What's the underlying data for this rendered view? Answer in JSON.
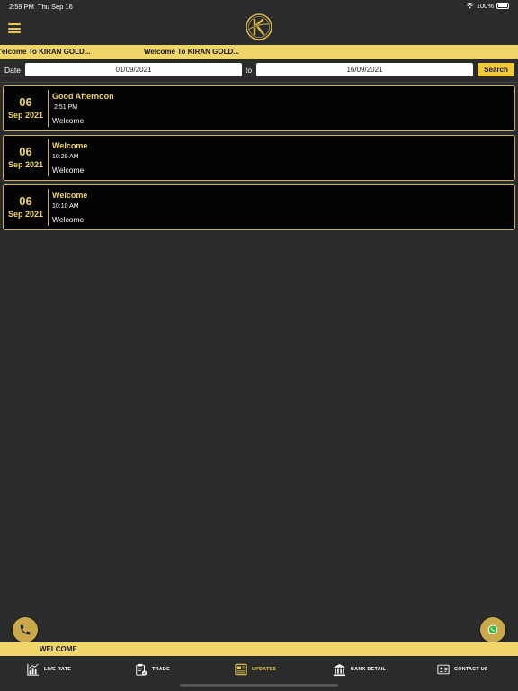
{
  "status": {
    "time": "2:59 PM",
    "date": "Thu Sep 16",
    "battery": "100%"
  },
  "marquee": {
    "items": [
      "'elcome To KIRAN GOLD...",
      "Welcome To KIRAN GOLD..."
    ]
  },
  "filter": {
    "date_label": "Date",
    "from_value": "01/09/2021",
    "to_label": "to",
    "to_value": "16/09/2021",
    "search_label": "Search"
  },
  "updates": [
    {
      "day": "06",
      "month": "Sep 2021",
      "title": "Good Afternoon",
      "time": "2:51 PM",
      "message": "Welcome"
    },
    {
      "day": "06",
      "month": "Sep 2021",
      "title": "Welcome",
      "time": "10:29 AM",
      "message": "Welcome"
    },
    {
      "day": "06",
      "month": "Sep 2021",
      "title": "Welcome",
      "time": "10:10 AM",
      "message": "Welcome"
    }
  ],
  "ticker": {
    "text": "WELCOME"
  },
  "tabs": [
    {
      "label": "LIVE RATE",
      "icon": "chart-icon"
    },
    {
      "label": "TRADE",
      "icon": "clipboard-icon"
    },
    {
      "label": "UPDATES",
      "icon": "news-icon",
      "active": true
    },
    {
      "label": "BANK DETAIL",
      "icon": "bank-icon"
    },
    {
      "label": "CONTACT US",
      "icon": "contact-card-icon"
    }
  ],
  "colors": {
    "accent": "#f0d568",
    "background": "#2b2b2b",
    "card": "#030303",
    "card_border": "#c9b25a"
  }
}
